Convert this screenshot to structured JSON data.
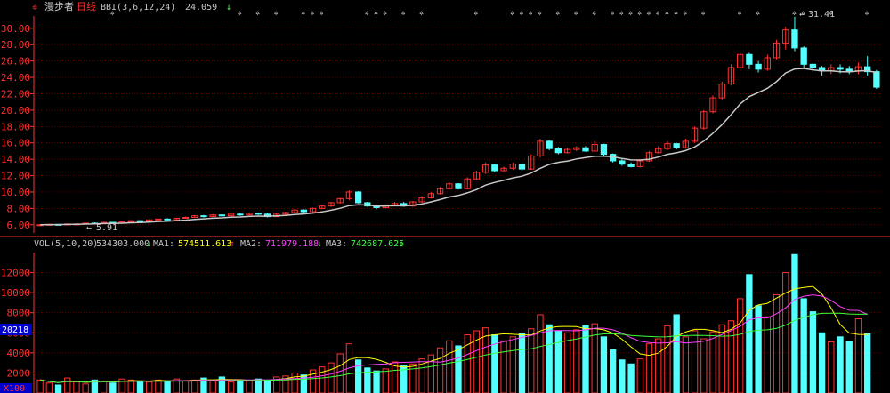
{
  "header": {
    "title_icon": "gear-icon",
    "stock_name": "漫步者",
    "period": "日线",
    "indicator_label": "BBI(3,6,12,24)",
    "indicator_value": "24.059",
    "indicator_arrow": "↓"
  },
  "vol_header": {
    "label": "VOL(5,10,20)",
    "vol_value": "534303.000",
    "vol_arrow": "↓",
    "ma1_label": "MA1:",
    "ma1_value": "574511.613",
    "ma1_arrow": "↑",
    "ma2_label": "MA2:",
    "ma2_value": "711979.188",
    "ma2_arrow": "↓",
    "ma3_label": "MA3:",
    "ma3_value": "742687.625",
    "ma3_arrow": "↓"
  },
  "annotations": {
    "high_label": "31.41",
    "low_label": "5.91",
    "vol_marker": "20218",
    "unit_marker": "X100"
  },
  "colors": {
    "up": "#ff3232",
    "down": "#54ffff",
    "bbi": "#c8c8c8",
    "ma1": "#ffff00",
    "ma2": "#ff40ff",
    "ma3": "#40ff40",
    "grid": "#8b0000",
    "axis_text": "#ff3232"
  },
  "chart_data": [
    {
      "type": "candlestick",
      "ylim": [
        5,
        31.5
      ],
      "yticks": [
        "6.00",
        "8.00",
        "10.00",
        "12.00",
        "14.00",
        "16.00",
        "18.00",
        "20.00",
        "22.00",
        "24.00",
        "26.00",
        "28.00",
        "30.00"
      ],
      "series": [
        {
          "name": "BBI(3,6,12,24)",
          "type": "line"
        }
      ],
      "candles": [
        [
          5.9,
          6.0,
          5.85,
          6.05
        ],
        [
          6.0,
          6.05,
          5.95,
          6.1
        ],
        [
          6.05,
          6.0,
          5.95,
          6.1
        ],
        [
          6.0,
          6.1,
          5.95,
          6.15
        ],
        [
          6.1,
          6.1,
          6.05,
          6.2
        ],
        [
          6.1,
          6.2,
          6.05,
          6.25
        ],
        [
          6.2,
          6.15,
          6.1,
          6.3
        ],
        [
          6.15,
          6.3,
          6.1,
          6.35
        ],
        [
          6.3,
          6.2,
          6.15,
          6.35
        ],
        [
          6.2,
          6.35,
          6.15,
          6.4
        ],
        [
          6.35,
          6.5,
          6.3,
          6.55
        ],
        [
          6.5,
          6.4,
          6.35,
          6.55
        ],
        [
          6.4,
          6.6,
          6.35,
          6.65
        ],
        [
          6.6,
          6.7,
          6.55,
          6.75
        ],
        [
          6.7,
          6.6,
          6.55,
          6.8
        ],
        [
          6.6,
          6.8,
          6.55,
          6.85
        ],
        [
          6.8,
          6.9,
          6.75,
          7.0
        ],
        [
          6.9,
          7.1,
          6.85,
          7.2
        ],
        [
          7.1,
          7.0,
          6.9,
          7.2
        ],
        [
          7.0,
          7.2,
          6.95,
          7.3
        ],
        [
          7.2,
          7.1,
          7.0,
          7.3
        ],
        [
          7.1,
          7.3,
          7.05,
          7.4
        ],
        [
          7.3,
          7.2,
          7.1,
          7.4
        ],
        [
          7.2,
          7.4,
          7.15,
          7.5
        ],
        [
          7.4,
          7.3,
          7.2,
          7.5
        ],
        [
          7.3,
          7.0,
          6.9,
          7.4
        ],
        [
          7.0,
          7.3,
          6.95,
          7.4
        ],
        [
          7.3,
          7.5,
          7.2,
          7.6
        ],
        [
          7.5,
          7.8,
          7.4,
          7.9
        ],
        [
          7.8,
          7.6,
          7.5,
          7.9
        ],
        [
          7.6,
          8.0,
          7.5,
          8.1
        ],
        [
          8.0,
          8.3,
          7.9,
          8.4
        ],
        [
          8.3,
          8.7,
          8.2,
          8.8
        ],
        [
          8.7,
          9.2,
          8.6,
          9.3
        ],
        [
          9.2,
          10.0,
          9.0,
          10.2
        ],
        [
          10.0,
          8.7,
          8.6,
          10.1
        ],
        [
          8.7,
          8.3,
          8.2,
          8.8
        ],
        [
          8.3,
          8.1,
          7.9,
          8.4
        ],
        [
          8.1,
          8.4,
          8.0,
          8.5
        ],
        [
          8.4,
          8.6,
          8.3,
          8.8
        ],
        [
          8.6,
          8.3,
          8.2,
          8.8
        ],
        [
          8.3,
          8.8,
          8.2,
          8.9
        ],
        [
          8.8,
          9.3,
          8.7,
          9.5
        ],
        [
          9.3,
          9.8,
          9.2,
          10.0
        ],
        [
          9.8,
          10.4,
          9.7,
          10.6
        ],
        [
          10.4,
          11.0,
          10.3,
          11.2
        ],
        [
          11.0,
          10.4,
          10.3,
          11.1
        ],
        [
          10.4,
          11.6,
          10.3,
          11.8
        ],
        [
          11.6,
          12.4,
          11.5,
          12.6
        ],
        [
          12.4,
          13.3,
          12.2,
          13.6
        ],
        [
          13.3,
          12.6,
          12.4,
          13.4
        ],
        [
          12.6,
          12.9,
          12.5,
          13.1
        ],
        [
          12.9,
          13.4,
          12.7,
          13.6
        ],
        [
          13.4,
          12.8,
          12.6,
          13.5
        ],
        [
          12.8,
          14.4,
          12.7,
          14.6
        ],
        [
          14.4,
          16.2,
          14.2,
          16.5
        ],
        [
          16.2,
          15.3,
          15.1,
          16.3
        ],
        [
          15.3,
          14.8,
          14.6,
          15.5
        ],
        [
          14.8,
          15.2,
          14.7,
          15.4
        ],
        [
          15.2,
          15.4,
          15.0,
          15.6
        ],
        [
          15.4,
          15.0,
          14.9,
          15.6
        ],
        [
          15.0,
          15.8,
          14.9,
          16.2
        ],
        [
          15.8,
          14.6,
          14.4,
          15.9
        ],
        [
          14.6,
          13.8,
          13.6,
          14.7
        ],
        [
          13.8,
          13.4,
          13.2,
          14.0
        ],
        [
          13.4,
          13.1,
          13.0,
          13.6
        ],
        [
          13.1,
          13.8,
          13.0,
          14.0
        ],
        [
          13.8,
          14.8,
          13.7,
          15.0
        ],
        [
          14.8,
          15.3,
          14.7,
          15.6
        ],
        [
          15.3,
          15.9,
          15.1,
          16.2
        ],
        [
          15.9,
          15.4,
          15.2,
          16.0
        ],
        [
          15.4,
          16.2,
          15.3,
          16.5
        ],
        [
          16.2,
          17.8,
          16.0,
          18.0
        ],
        [
          17.8,
          19.8,
          17.6,
          20.0
        ],
        [
          19.8,
          21.5,
          19.6,
          21.8
        ],
        [
          21.5,
          23.2,
          21.3,
          23.5
        ],
        [
          23.2,
          25.2,
          23.0,
          25.6
        ],
        [
          25.2,
          26.8,
          24.8,
          27.2
        ],
        [
          26.8,
          25.6,
          25.0,
          27.0
        ],
        [
          25.6,
          25.0,
          24.6,
          26.0
        ],
        [
          25.0,
          26.4,
          24.8,
          26.8
        ],
        [
          26.4,
          28.2,
          26.2,
          28.6
        ],
        [
          28.2,
          29.8,
          27.4,
          30.2
        ],
        [
          29.8,
          27.6,
          27.2,
          31.41
        ],
        [
          27.6,
          25.6,
          25.2,
          27.8
        ],
        [
          25.6,
          25.2,
          24.6,
          25.8
        ],
        [
          25.2,
          24.8,
          24.2,
          25.4
        ],
        [
          24.8,
          25.2,
          24.4,
          25.6
        ],
        [
          25.2,
          25.0,
          24.5,
          25.6
        ],
        [
          25.0,
          24.8,
          24.4,
          25.4
        ],
        [
          24.8,
          25.3,
          24.4,
          25.8
        ],
        [
          25.3,
          24.7,
          24.2,
          26.6
        ],
        [
          24.7,
          22.8,
          22.6,
          24.9
        ]
      ]
    },
    {
      "type": "bar",
      "ylim": [
        0,
        14000
      ],
      "yticks": [
        "2000",
        "4000",
        "6000",
        "8000",
        "10000",
        "12000"
      ],
      "series": [
        {
          "name": "MA1",
          "type": "line"
        },
        {
          "name": "MA2",
          "type": "line"
        },
        {
          "name": "MA3",
          "type": "line"
        }
      ],
      "values": [
        1300,
        1000,
        800,
        1500,
        1100,
        900,
        1300,
        1200,
        1000,
        1400,
        1300,
        1200,
        1100,
        1300,
        1200,
        1400,
        1200,
        1300,
        1500,
        1200,
        1600,
        1100,
        1300,
        1200,
        1400,
        1300,
        1600,
        1700,
        2000,
        1800,
        2300,
        2600,
        3000,
        3900,
        4900,
        3300,
        2500,
        2200,
        2400,
        3100,
        2700,
        2900,
        3400,
        3800,
        4500,
        5200,
        4700,
        5800,
        6200,
        6500,
        5800,
        5200,
        5600,
        5900,
        6400,
        7800,
        6800,
        6200,
        6000,
        6300,
        6700,
        6900,
        5600,
        4300,
        3300,
        2900,
        3400,
        4900,
        5400,
        6700,
        7800,
        5600,
        6200,
        5400,
        6100,
        6800,
        7200,
        9400,
        11800,
        8700,
        7600,
        9800,
        12000,
        13800,
        9400,
        8100,
        6000,
        5100,
        5600,
        5100,
        7400,
        5900
      ]
    }
  ]
}
